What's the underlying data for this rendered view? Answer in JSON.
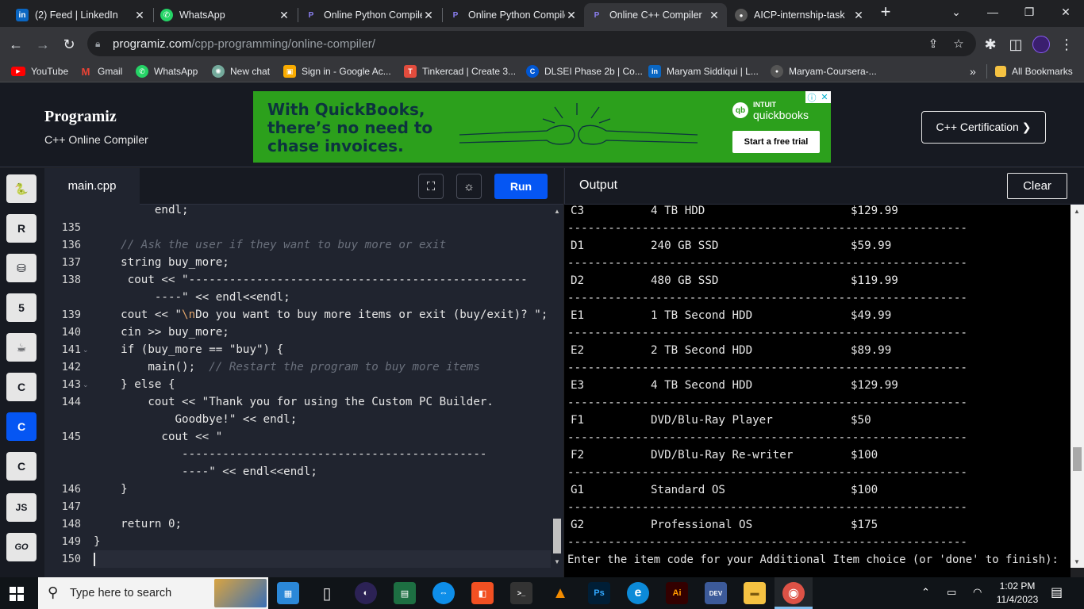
{
  "browser": {
    "tabs": [
      {
        "title": "(2) Feed | LinkedIn",
        "icon": "linkedin-icon",
        "color": "#0a66c2",
        "glyph": "in"
      },
      {
        "title": "WhatsApp",
        "icon": "whatsapp-icon",
        "color": "#25d366",
        "glyph": "✆"
      },
      {
        "title": "Online Python Compiler",
        "icon": "programiz-icon",
        "color": "#3b2a8a",
        "glyph": "P"
      },
      {
        "title": "Online Python Compiler",
        "icon": "programiz-icon",
        "color": "#3b2a8a",
        "glyph": "P"
      },
      {
        "title": "Online C++ Compiler",
        "icon": "programiz-icon",
        "color": "#3b2a8a",
        "glyph": "P"
      },
      {
        "title": "AICP-internship-task",
        "icon": "github-icon",
        "color": "#555555",
        "glyph": "●"
      }
    ],
    "new_tab": "+",
    "url_host": "programiz.com",
    "url_path": "/cpp-programming/online-compiler/",
    "bookmarks": [
      {
        "label": "YouTube",
        "icon": "youtube-icon",
        "color": "#ff0000",
        "glyph": "▶"
      },
      {
        "label": "Gmail",
        "icon": "gmail-icon",
        "color": "#ea4335",
        "glyph": "M"
      },
      {
        "label": "WhatsApp",
        "icon": "whatsapp-icon",
        "color": "#25d366",
        "glyph": "✆"
      },
      {
        "label": "New chat",
        "icon": "openai-icon",
        "color": "#74aa9c",
        "glyph": "✺"
      },
      {
        "label": "Sign in - Google Ac...",
        "icon": "google-classroom-icon",
        "color": "#f9ab00",
        "glyph": "▣"
      },
      {
        "label": "Tinkercad | Create 3...",
        "icon": "tinkercad-icon",
        "color": "#e24c3d",
        "glyph": "T"
      },
      {
        "label": "DLSEI Phase 2b | Co...",
        "icon": "coursera-icon",
        "color": "#0056d2",
        "glyph": "C"
      },
      {
        "label": "Maryam Siddiqui | L...",
        "icon": "linkedin-icon",
        "color": "#0a66c2",
        "glyph": "in"
      },
      {
        "label": "Maryam-Coursera-...",
        "icon": "github-icon",
        "color": "#555555",
        "glyph": "●"
      }
    ],
    "bookmarks_overflow": "»",
    "all_bookmarks": "All Bookmarks"
  },
  "site": {
    "logo": "Programiz",
    "subtitle": "C++ Online Compiler",
    "ad": {
      "headline": "With QuickBooks, there’s no need to chase invoices.",
      "brand_top": "INTUIT",
      "brand": "quickbooks",
      "brand_mark": "qb",
      "cta": "Start a free trial"
    },
    "cert_button": "C++ Certification ❯"
  },
  "sidebar": {
    "languages": [
      {
        "name": "python",
        "glyph": "🐍"
      },
      {
        "name": "r",
        "glyph": "R"
      },
      {
        "name": "sql",
        "glyph": "⛁"
      },
      {
        "name": "html",
        "glyph": "5"
      },
      {
        "name": "java",
        "glyph": "☕"
      },
      {
        "name": "c",
        "glyph": "C"
      },
      {
        "name": "cpp",
        "glyph": "C"
      },
      {
        "name": "csharp",
        "glyph": "C"
      },
      {
        "name": "js",
        "glyph": "JS"
      },
      {
        "name": "go",
        "glyph": "GO"
      }
    ],
    "active_index": 6
  },
  "editor": {
    "file_name": "main.cpp",
    "run_label": "Run",
    "line_numbers": [
      "135",
      "136",
      "137",
      "138",
      "139",
      "140",
      "141",
      "142",
      "143",
      "144",
      "145",
      "146",
      "147",
      "148",
      "149",
      "150"
    ],
    "fold_markers": [
      "141",
      "143"
    ]
  },
  "output": {
    "title": "Output",
    "clear_label": "Clear",
    "rows": [
      {
        "code": "C3",
        "desc": "4 TB HDD",
        "price": "$129.99"
      },
      {
        "code": "D1",
        "desc": "240 GB SSD",
        "price": "$59.99"
      },
      {
        "code": "D2",
        "desc": "480 GB SSD",
        "price": "$119.99"
      },
      {
        "code": "E1",
        "desc": "1 TB Second HDD",
        "price": "$49.99"
      },
      {
        "code": "E2",
        "desc": "2 TB Second HDD",
        "price": "$89.99"
      },
      {
        "code": "E3",
        "desc": "4 TB Second HDD",
        "price": "$129.99"
      },
      {
        "code": "F1",
        "desc": "DVD/Blu-Ray Player",
        "price": "$50"
      },
      {
        "code": "F2",
        "desc": "DVD/Blu-Ray Re-writer",
        "price": "$100"
      },
      {
        "code": "G1",
        "desc": "Standard OS",
        "price": "$100"
      },
      {
        "code": "G2",
        "desc": "Professional OS",
        "price": "$175"
      }
    ],
    "separator": "-----------------------------------------------------------",
    "prompt": "Enter the item code for your Additional Item choice (or 'done' to finish):"
  },
  "taskbar": {
    "search_placeholder": "Type here to search",
    "time": "1:02 PM",
    "date": "11/4/2023",
    "apps": [
      {
        "name": "task-view-icon",
        "color": "#2b88d8",
        "glyph": "▦"
      },
      {
        "name": "file-icon",
        "color": "#e6e6e6",
        "glyph": "▯"
      },
      {
        "name": "eclipse-icon",
        "color": "#2c2255",
        "glyph": "◐"
      },
      {
        "name": "excel-chart-icon",
        "color": "#1d6f42",
        "glyph": "▤"
      },
      {
        "name": "teamviewer-icon",
        "color": "#0e8ee9",
        "glyph": "⇔"
      },
      {
        "name": "office-icon",
        "color": "#f25022",
        "glyph": "◧"
      },
      {
        "name": "terminal-icon",
        "color": "#333333",
        "glyph": ">_"
      },
      {
        "name": "vlc-icon",
        "color": "#f28b00",
        "glyph": "▲"
      },
      {
        "name": "photoshop-icon",
        "color": "#001e36",
        "glyph": "Ps"
      },
      {
        "name": "edge-icon",
        "color": "#0c8ad8",
        "glyph": "e"
      },
      {
        "name": "illustrator-icon",
        "color": "#330000",
        "glyph": "Ai"
      },
      {
        "name": "devcpp-icon",
        "color": "#3c5a99",
        "glyph": "DEV"
      },
      {
        "name": "explorer-icon",
        "color": "#f5c242",
        "glyph": "▬"
      },
      {
        "name": "chrome-icon",
        "color": "#db4437",
        "glyph": "◉"
      }
    ]
  }
}
